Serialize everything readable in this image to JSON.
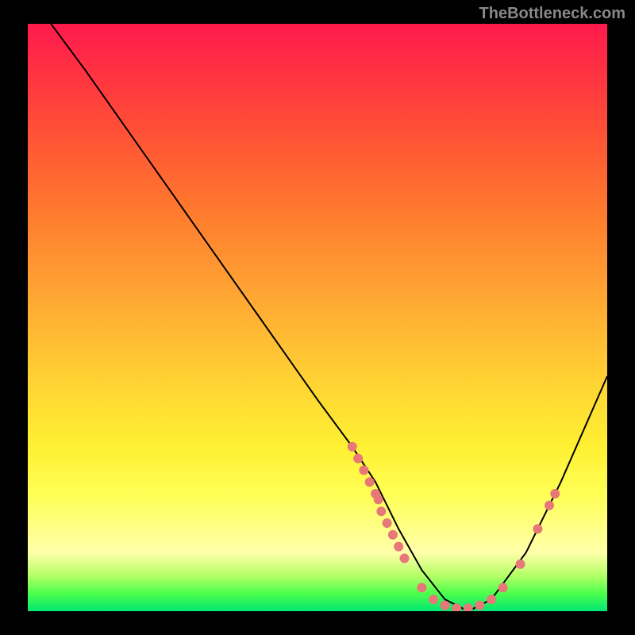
{
  "watermark": "TheBottleneck.com",
  "chart_data": {
    "type": "line",
    "title": "",
    "xlabel": "",
    "ylabel": "",
    "xlim": [
      0,
      100
    ],
    "ylim": [
      0,
      100
    ],
    "curve": {
      "x": [
        4,
        10,
        20,
        30,
        40,
        50,
        56,
        60,
        64,
        68,
        72,
        76,
        80,
        86,
        92,
        100
      ],
      "y": [
        100,
        92,
        78,
        64,
        50,
        36,
        28,
        22,
        14,
        7,
        2,
        0,
        2,
        10,
        22,
        40
      ]
    },
    "highlight_points": [
      {
        "x": 56,
        "y": 28
      },
      {
        "x": 57,
        "y": 26
      },
      {
        "x": 58,
        "y": 24
      },
      {
        "x": 59,
        "y": 22
      },
      {
        "x": 60,
        "y": 20
      },
      {
        "x": 60.5,
        "y": 19
      },
      {
        "x": 61,
        "y": 17
      },
      {
        "x": 62,
        "y": 15
      },
      {
        "x": 63,
        "y": 13
      },
      {
        "x": 64,
        "y": 11
      },
      {
        "x": 65,
        "y": 9
      },
      {
        "x": 68,
        "y": 4
      },
      {
        "x": 70,
        "y": 2
      },
      {
        "x": 72,
        "y": 1
      },
      {
        "x": 74,
        "y": 0.5
      },
      {
        "x": 76,
        "y": 0.5
      },
      {
        "x": 78,
        "y": 1
      },
      {
        "x": 80,
        "y": 2
      },
      {
        "x": 82,
        "y": 4
      },
      {
        "x": 85,
        "y": 8
      },
      {
        "x": 88,
        "y": 14
      },
      {
        "x": 90,
        "y": 18
      },
      {
        "x": 91,
        "y": 20
      }
    ],
    "colors": {
      "curve": "#000000",
      "points": "#e87878"
    }
  }
}
